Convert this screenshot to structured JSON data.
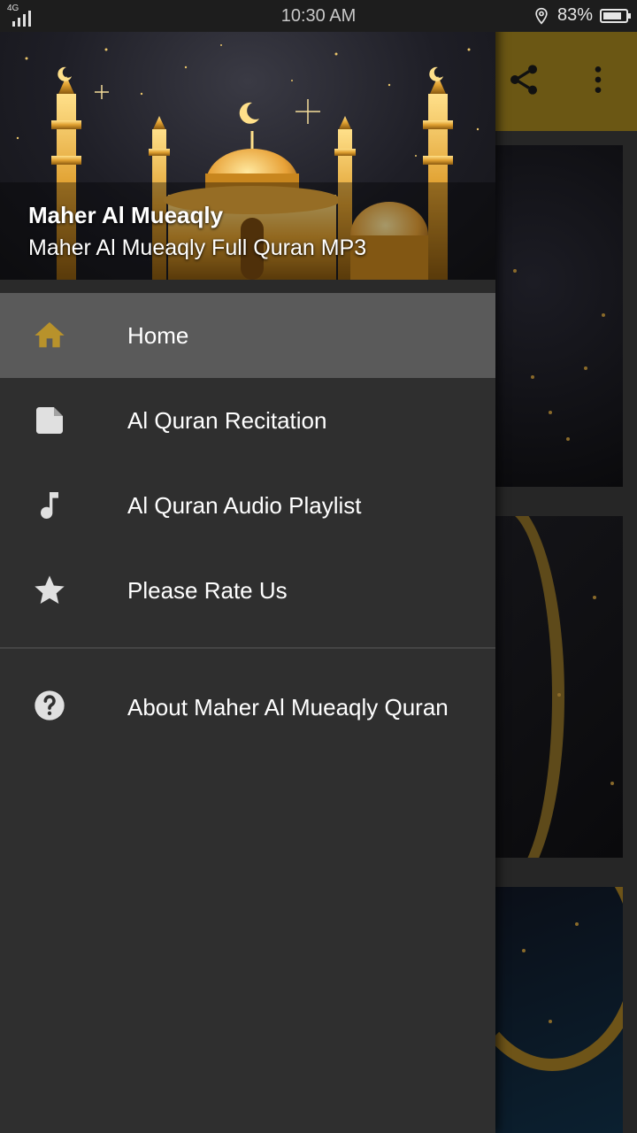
{
  "status_bar": {
    "network": "4G",
    "time": "10:30 AM",
    "battery": "83%",
    "battery_level": 0.83
  },
  "drawer": {
    "header": {
      "title": "Maher Al Mueaqly",
      "subtitle": "Maher Al Mueaqly Full Quran MP3"
    },
    "items": [
      {
        "label": "Home",
        "icon": "home-icon",
        "active": true
      },
      {
        "label": "Al Quran Recitation",
        "icon": "note-icon",
        "active": false
      },
      {
        "label": "Al Quran Audio Playlist",
        "icon": "music-note-icon",
        "active": false
      },
      {
        "label": "Please Rate Us",
        "icon": "star-icon",
        "active": false
      }
    ],
    "secondary_items": [
      {
        "label": "About Maher Al Mueaqly Quran",
        "icon": "help-icon"
      }
    ]
  },
  "app_bar": {
    "actions": [
      "share-icon",
      "more-vert-icon"
    ]
  },
  "colors": {
    "accent_gold": "#b8922b",
    "drawer_bg": "#2f2f2f",
    "active_item_bg": "#5a5a5a",
    "app_bar_dimmed": "#6b5714"
  }
}
